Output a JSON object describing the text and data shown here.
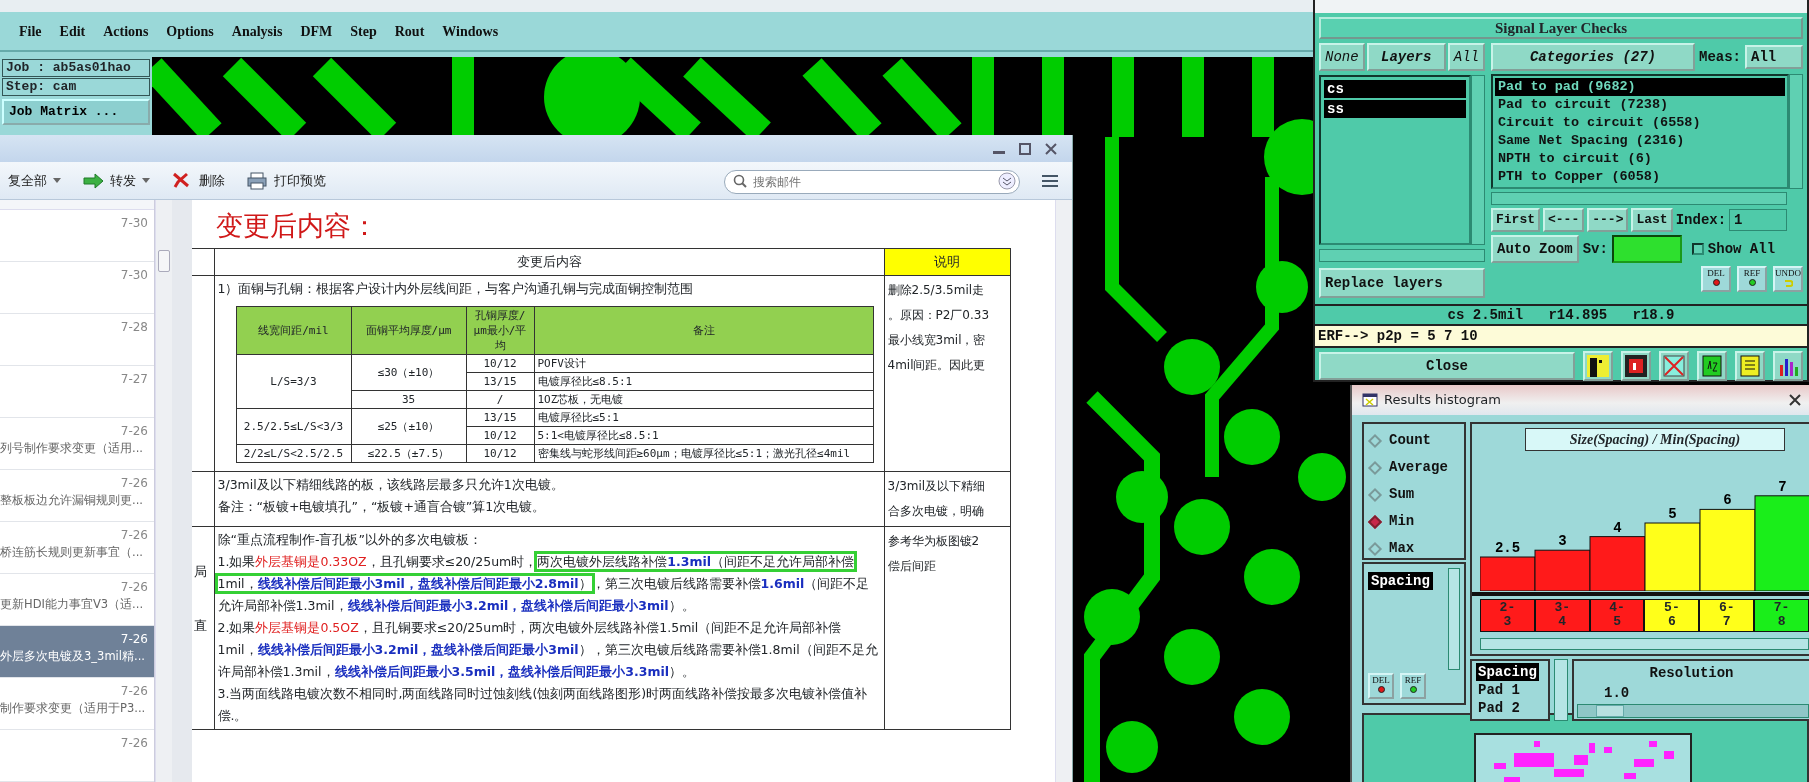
{
  "cam_window": {
    "menu": [
      "File",
      "Edit",
      "Actions",
      "Options",
      "Analysis",
      "DFM",
      "Step",
      "Rout",
      "Windows"
    ],
    "job": "Job : ab5as01hao",
    "step": "Step: cam",
    "job_matrix_button": "Job Matrix ..."
  },
  "mail_window": {
    "toolbar": [
      {
        "kind": "reply_all",
        "label": "复全部",
        "dropdown": true
      },
      {
        "kind": "forward",
        "label": "转发",
        "dropdown": true
      },
      {
        "kind": "delete",
        "label": "删除",
        "dropdown": false
      },
      {
        "kind": "print",
        "label": "打印预览",
        "dropdown": false
      }
    ],
    "search": {
      "placeholder": "搜索邮件"
    },
    "mail_list": [
      {
        "date": "7-30",
        "selected": false
      },
      {
        "date": "7-30",
        "selected": false
      },
      {
        "date": "7-28",
        "selected": false
      },
      {
        "date": "7-27",
        "selected": false
      },
      {
        "date": "7-26",
        "subject": "列号制作要求变更（适用...",
        "selected": false
      },
      {
        "date": "7-26",
        "subject": "整板板边允许漏铜规则更...",
        "selected": false
      },
      {
        "date": "7-26",
        "subject": "桥连筋长规则更新事宜（...",
        "selected": false
      },
      {
        "date": "7-26",
        "subject": "更新HDI能力事宜V3（适...",
        "selected": false
      },
      {
        "date": "7-26",
        "subject": "外层多次电镀及3_3mil精...",
        "selected": true
      },
      {
        "date": "7-26",
        "subject": "制作要求变更（适用于P3...",
        "selected": false
      },
      {
        "date": "7-26",
        "selected": false
      }
    ],
    "message": {
      "heading": "变更后内容：",
      "header": "变更后内容",
      "note_header": "说明",
      "row_1": {
        "intro": "1）面铜与孔铜：根据客户设计内外层线间距，与客户沟通孔铜与完成面铜控制范围",
        "spec_table": {
          "columns": [
            "线宽间距/mil",
            "面铜平均厚度/μm",
            "孔铜厚度/μm最小/平均",
            "备注"
          ],
          "groups": [
            {
              "spacing": "L/S=3/3",
              "thickness": [
                {
                  "value": "≤30（±10）",
                  "rows": [
                    {
                      "hole": "10/12",
                      "remark": "POFV设计"
                    },
                    {
                      "hole": "13/15",
                      "remark": "电镀厚径比≤8.5:1"
                    }
                  ]
                },
                {
                  "value": "35",
                  "rows": [
                    {
                      "hole": "/",
                      "remark": "1OZ芯板，无电镀"
                    }
                  ]
                }
              ]
            },
            {
              "spacing": "2.5/2.5≤L/S<3/3",
              "thickness": [
                {
                  "value": "≤25（±10）",
                  "rows": [
                    {
                      "hole": "13/15",
                      "remark": "电镀厚径比≤5:1"
                    },
                    {
                      "hole": "10/12",
                      "remark": "5:1<电镀厚径比≤8.5:1"
                    }
                  ]
                }
              ]
            },
            {
              "spacing": "2/2≤L/S<2.5/2.5",
              "thickness": [
                {
                  "value": "≤22.5（±7.5）",
                  "rows": [
                    {
                      "hole": "10/12",
                      "remark": "密集线与蛇形线间距≥60μm；电镀厚径比≤5:1；激光孔径≤4mil"
                    }
                  ]
                }
              ]
            }
          ]
        },
        "notes": [
          "删除2.5/3.5mil走",
          "。原因：P2厂0.33",
          "最小线宽3mil，密",
          "4mil间距。因此更"
        ]
      },
      "row_2": {
        "lines": [
          "3/3mil及以下精细线路的板，该线路层最多只允许1次电镀。",
          "备注：“板镀+电镀填孔”，“板镀+通盲合镀”算1次电镀。"
        ],
        "notes": [
          "3/3mil及以下精细",
          "合多次电镀，明确"
        ]
      },
      "row_3": {
        "side_marks": [
          "局",
          "直"
        ],
        "intro": "除“重点流程制作-盲孔板”以外的多次电镀板：",
        "paragraphs": [
          {
            "parts": [
              {
                "highlighted": false,
                "runs": [
                  {
                    "kind": "plain",
                    "text": "1.如果"
                  },
                  {
                    "kind": "red",
                    "text": "外层基铜是0.33OZ"
                  },
                  {
                    "kind": "plain",
                    "text": "，且孔铜要求≤20/25um时，"
                  }
                ]
              },
              {
                "highlighted": true,
                "runs": [
                  {
                    "kind": "plain",
                    "text": "两次电镀外层线路补偿"
                  },
                  {
                    "kind": "blue",
                    "text": "1.3mil"
                  },
                  {
                    "kind": "plain",
                    "text": "（间距不足允许局部补偿1mil，"
                  },
                  {
                    "kind": "blue",
                    "text": "线线补偿后间距最小3mil，盘线补偿后间距最小2.8mil"
                  },
                  {
                    "kind": "plain",
                    "text": "）"
                  }
                ]
              },
              {
                "highlighted": false,
                "runs": [
                  {
                    "kind": "plain",
                    "text": "，第三次电镀后线路需要补偿"
                  },
                  {
                    "kind": "blue",
                    "text": "1.6mil"
                  },
                  {
                    "kind": "plain",
                    "text": "（间距不足允许局部补偿1.3mil，"
                  },
                  {
                    "kind": "blue",
                    "text": "线线补偿后间距最小3.2mil，盘线补偿后间距最小3mil"
                  },
                  {
                    "kind": "plain",
                    "text": "）。"
                  }
                ]
              }
            ]
          },
          {
            "parts": [
              {
                "highlighted": false,
                "runs": [
                  {
                    "kind": "plain",
                    "text": "2.如果"
                  },
                  {
                    "kind": "red",
                    "text": "外层基铜是0.5OZ"
                  },
                  {
                    "kind": "plain",
                    "text": "，且孔铜要求≤20/25um时，两次电镀外层线路补偿1.5mil（间距不足允许局部补偿1mil，"
                  },
                  {
                    "kind": "blue",
                    "text": "线线补偿后间距最小3.2mil，盘线补偿后间距最小3mil"
                  },
                  {
                    "kind": "plain",
                    "text": "），第三次电镀后线路需要补偿1.8mil（间距不足允许局部补偿1.3mil，"
                  },
                  {
                    "kind": "blue",
                    "text": "线线补偿后间距最小3.5mil，盘线补偿后间距最小3.3mil"
                  },
                  {
                    "kind": "plain",
                    "text": "）。"
                  }
                ]
              }
            ]
          },
          {
            "parts": [
              {
                "highlighted": false,
                "runs": [
                  {
                    "kind": "plain",
                    "text": "3.当两面线路电镀次数不相同时,两面线路同时过蚀刻线(蚀刻两面线路图形)时两面线路补偿按最多次电镀补偿值补偿.。"
                  }
                ]
              }
            ]
          }
        ],
        "notes": [
          "参考华为板图镀2",
          "偿后间距"
        ]
      }
    }
  },
  "results_viewer": {
    "title": "Signal Layer Checks",
    "none_button": "None",
    "layers_label": "Layers",
    "all_button": "All",
    "layers": [
      {
        "name": "cs",
        "selected": true
      },
      {
        "name": "ss",
        "selected": true
      }
    ],
    "categories_header": "Categories (27)",
    "meas_label": "Meas:",
    "meas_value": "All",
    "categories": [
      {
        "label": "Pad to pad (9682)",
        "selected": true
      },
      {
        "label": "Pad to circuit (7238)",
        "selected": false
      },
      {
        "label": "Circuit to circuit (6558)",
        "selected": false
      },
      {
        "label": "Same Net Spacing (2316)",
        "selected": false
      },
      {
        "label": "NPTH to circuit (6)",
        "selected": false
      },
      {
        "label": "PTH to Copper (6058)",
        "selected": false
      }
    ],
    "nav_buttons": [
      "First",
      "<---",
      "--->",
      "Last"
    ],
    "index_label": "Index:",
    "index_value": "1",
    "auto_zoom": "Auto Zoom",
    "sv_label": "Sv:",
    "show_all": {
      "label": "Show All",
      "checked": false
    },
    "replace_layers": "Replace layers",
    "action_icons": [
      {
        "kind": "del",
        "label": "DEL"
      },
      {
        "kind": "ref",
        "label": "REF"
      },
      {
        "kind": "undo",
        "label": "UNDO"
      }
    ],
    "status": "cs 2.5mil   r14.895   r18.9",
    "command": "ERF--> p2p = 5 7 10",
    "close": "Close"
  },
  "histogram": {
    "title": "Results histogram",
    "stats": [
      {
        "label": "Count",
        "selected": false
      },
      {
        "label": "Average",
        "selected": false
      },
      {
        "label": "Sum",
        "selected": false
      },
      {
        "label": "Min",
        "selected": true
      },
      {
        "label": "Max",
        "selected": false
      }
    ],
    "fields": [
      {
        "label": "Spacing",
        "selected": true
      }
    ],
    "action_icons": [
      {
        "kind": "del",
        "label": "DEL"
      },
      {
        "kind": "ref",
        "label": "REF"
      }
    ],
    "chart_data": {
      "type": "bar",
      "title": "Size(Spacing) / Min(Spacing)",
      "categories": [
        "2-3",
        "3-4",
        "4-5",
        "5-6",
        "6-7",
        "7-8"
      ],
      "values": [
        2.5,
        3,
        4,
        5,
        6,
        7
      ],
      "data_labels": true
    },
    "bins": [
      {
        "color": "#ff1a1a"
      },
      {
        "color": "#ff1a1a"
      },
      {
        "color": "#ff1a1a"
      },
      {
        "color": "#ffff1a"
      },
      {
        "color": "#ffff1a"
      },
      {
        "color": "#1aee1a"
      }
    ],
    "attributes": [
      {
        "label": "Spacing",
        "selected": true
      },
      {
        "label": "Pad 1",
        "selected": false
      },
      {
        "label": "Pad 2",
        "selected": false
      }
    ],
    "resolution_label": "Resolution",
    "resolution_value": "1.0",
    "resolution": {
      "level": 0.08
    }
  }
}
